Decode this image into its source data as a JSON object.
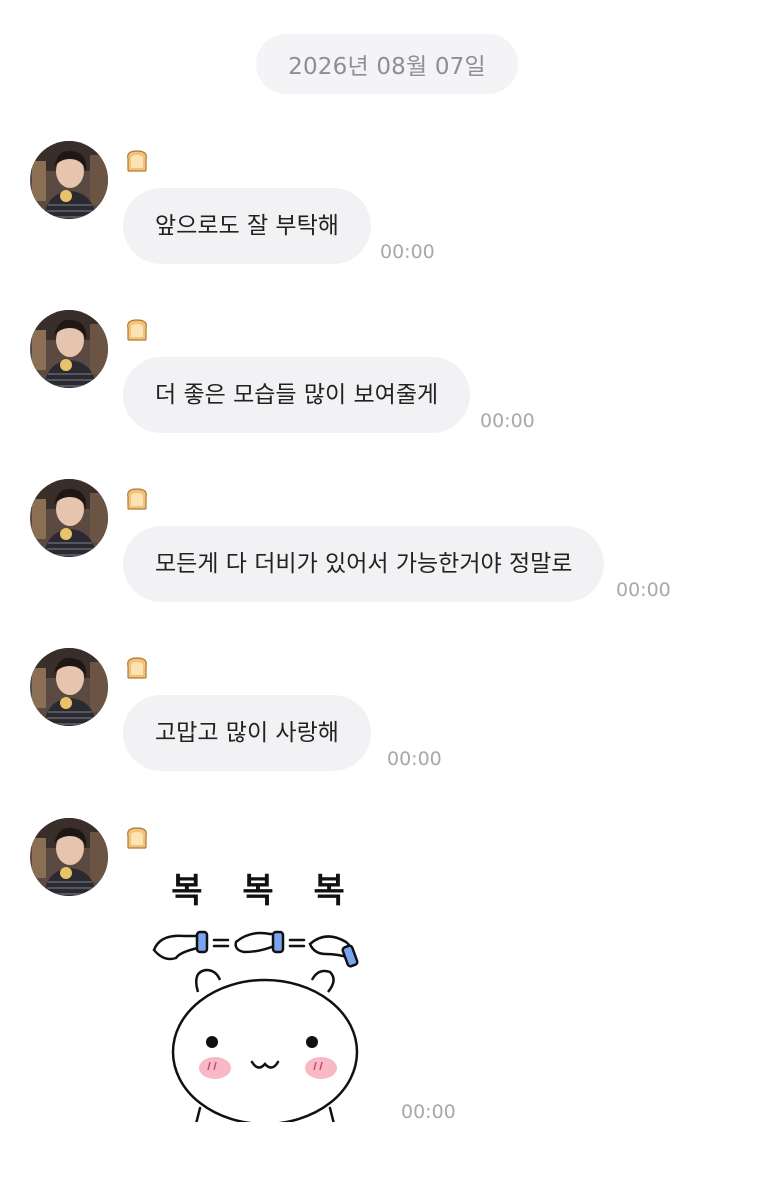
{
  "chat": {
    "date": "2026년 08월 07일",
    "sender_badge_icon": "bread-icon",
    "messages": [
      {
        "text": "앞으로도 잘 부탁해",
        "time": "00:00"
      },
      {
        "text": "더 좋은 모습들 많이 보여줄게",
        "time": "00:00"
      },
      {
        "text": "모든게 다 더비가 있어서 가능한거야 정말로",
        "time": "00:00"
      },
      {
        "text": "고맙고 많이 사랑해",
        "time": "00:00"
      }
    ],
    "sticker": {
      "caption": "복 복 복",
      "icon": "patting-bear-sticker",
      "time": "00:00"
    }
  },
  "colors": {
    "bubble_bg": "#f2f2f4",
    "date_pill_bg": "#f4f4f6",
    "time_text": "#a8a8ad",
    "message_text": "#222222"
  }
}
